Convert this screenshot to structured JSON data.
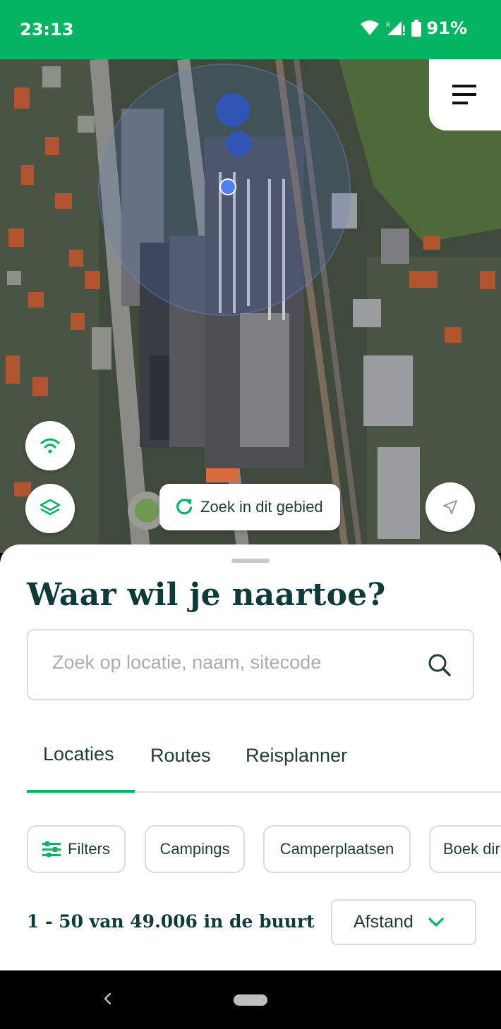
{
  "status_bar": {
    "time": "23:13",
    "battery": "91%",
    "background": "#05b462"
  },
  "map": {
    "search_area_label": "Zoek in dit gebied"
  },
  "sheet": {
    "title": "Waar wil je naartoe?",
    "search": {
      "placeholder": "Zoek op locatie, naam, sitecode",
      "value": ""
    },
    "tabs": [
      {
        "label": "Locaties",
        "active": true
      },
      {
        "label": "Routes",
        "active": false
      },
      {
        "label": "Reisplanner",
        "active": false
      }
    ],
    "chips": [
      {
        "label": "Filters",
        "icon": "filter-sliders-icon"
      },
      {
        "label": "Campings"
      },
      {
        "label": "Camperplaatsen"
      },
      {
        "label": "Boek dir"
      }
    ],
    "results_count": "1 - 50 van 49.006 in de buurt",
    "sort": {
      "selected": "Afstand"
    }
  },
  "colors": {
    "brand_green": "#05b462",
    "text_dark": "#0e3b39"
  },
  "icons": [
    "wifi-icon",
    "signal-icon",
    "battery-icon",
    "menu-icon",
    "layers-icon",
    "refresh-icon",
    "navigation-arrow-icon",
    "search-icon",
    "chevron-down-icon",
    "back-icon"
  ]
}
